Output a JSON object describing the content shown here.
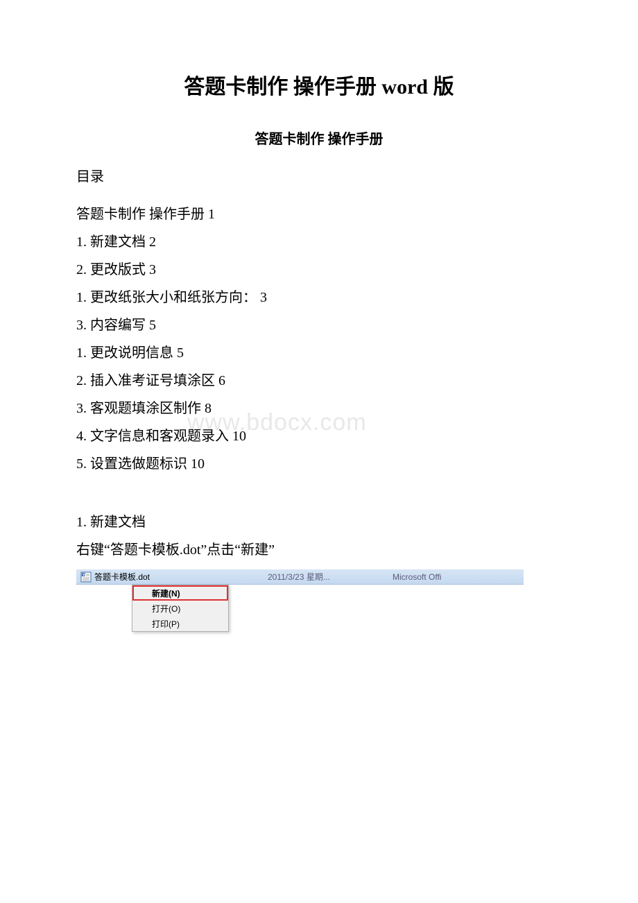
{
  "title": "答题卡制作 操作手册 word 版",
  "subtitle": "答题卡制作 操作手册",
  "tocLabel": "目录",
  "tocItems": [
    "答题卡制作 操作手册 1",
    "1. 新建文档 2",
    "2. 更改版式 3",
    "1. 更改纸张大小和纸张方向： 3",
    "3. 内容编写 5",
    "1. 更改说明信息 5",
    "2. 插入准考证号填涂区 6",
    "3. 客观题填涂区制作 8",
    "4. 文字信息和客观题录入 10",
    "5. 设置选做题标识 10"
  ],
  "section1": {
    "header": "1. 新建文档",
    "text": "右键“答题卡模板.dot”点击“新建”"
  },
  "watermark": "www.bdocx.com",
  "fileRow": {
    "name": "答题卡模板.dot",
    "date": "2011/3/23 星期...",
    "type": "Microsoft Offi"
  },
  "contextMenu": {
    "items": [
      {
        "label": "新建(N)",
        "highlighted": true
      },
      {
        "label": "打开(O)",
        "highlighted": false
      },
      {
        "label": "打印(P)",
        "highlighted": false
      }
    ]
  }
}
